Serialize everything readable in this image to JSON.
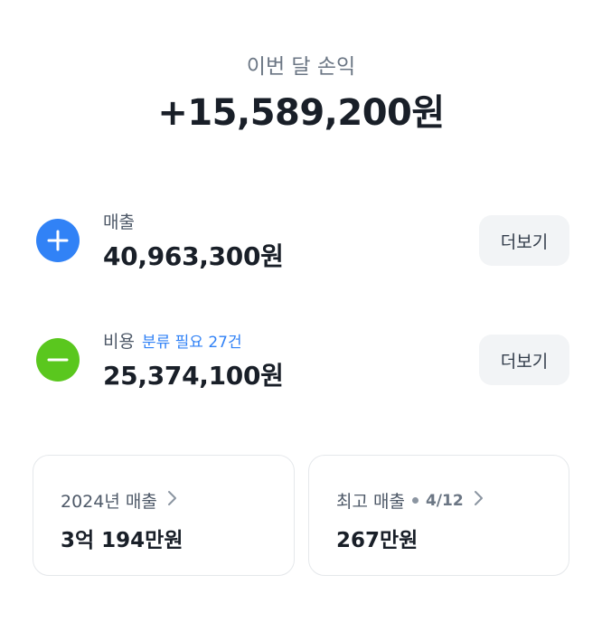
{
  "summary": {
    "label": "이번 달 손익",
    "amount": "+15,589,200원"
  },
  "revenue": {
    "label": "매출",
    "amount": "40,963,300원",
    "more_label": "더보기",
    "icon": "plus-icon",
    "color": "#3182f6"
  },
  "expense": {
    "label": "비용",
    "sub_label": "분류 필요 27건",
    "amount": "25,374,100원",
    "more_label": "더보기",
    "icon": "minus-icon",
    "color": "#5ac71e"
  },
  "cards": {
    "year": {
      "label": "2024년 매출",
      "value": "3억 194만원",
      "icon": "chevron-right-icon"
    },
    "best": {
      "label": "최고 매출",
      "date": "4/12",
      "value": "267만원",
      "icon": "chevron-right-icon"
    }
  }
}
